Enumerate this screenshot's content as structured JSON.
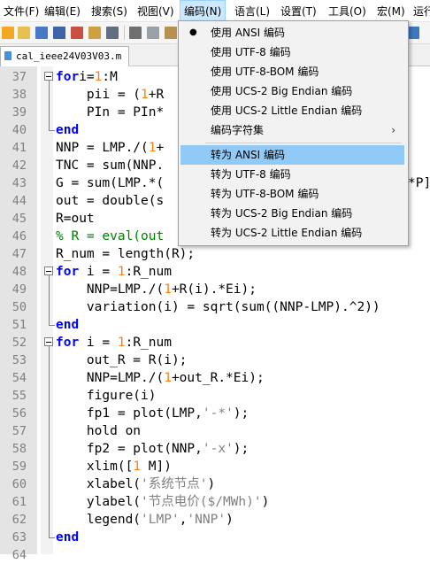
{
  "menubar": {
    "items": [
      {
        "label": "文件(F)"
      },
      {
        "label": "编辑(E)"
      },
      {
        "label": "搜索(S)"
      },
      {
        "label": "视图(V)"
      },
      {
        "label": "编码(N)"
      },
      {
        "label": "语言(L)"
      },
      {
        "label": "设置(T)"
      },
      {
        "label": "工具(O)"
      },
      {
        "label": "宏(M)"
      },
      {
        "label": "运行"
      }
    ]
  },
  "tab": {
    "label": "cal_ieee24V03V03.m"
  },
  "editor": {
    "lines": [
      {
        "n": "37",
        "segs": [
          [
            "kw",
            "for"
          ],
          [
            "",
            "i="
          ],
          [
            "num",
            "1"
          ],
          [
            "",
            ":M"
          ]
        ]
      },
      {
        "n": "38",
        "segs": [
          [
            "",
            "    pii = ("
          ],
          [
            "num",
            "1"
          ],
          [
            "",
            "+R"
          ]
        ]
      },
      {
        "n": "39",
        "segs": [
          [
            "",
            "    PIn = PIn*"
          ]
        ]
      },
      {
        "n": "40",
        "segs": [
          [
            "kw",
            "end"
          ]
        ]
      },
      {
        "n": "41",
        "segs": [
          [
            "",
            "NNP = LMP./("
          ],
          [
            "num",
            "1"
          ],
          [
            "",
            "+"
          ]
        ]
      },
      {
        "n": "42",
        "segs": [
          [
            "",
            "TNC = sum(NNP."
          ]
        ]
      },
      {
        "n": "43",
        "segs": [
          [
            "",
            "G = sum(LMP.*("
          ]
        ]
      },
      {
        "n": "44",
        "segs": [
          [
            "",
            "out = double(s"
          ]
        ]
      },
      {
        "n": "45",
        "segs": [
          [
            "",
            "R=out"
          ]
        ]
      },
      {
        "n": "46",
        "segs": [
          [
            "cmt",
            "% R = eval(out"
          ]
        ]
      },
      {
        "n": "47",
        "segs": [
          [
            "",
            "R_num = length(R);"
          ]
        ]
      },
      {
        "n": "48",
        "segs": [
          [
            "kw",
            "for"
          ],
          [
            "",
            " i = "
          ],
          [
            "num",
            "1"
          ],
          [
            "",
            ":R_num"
          ]
        ]
      },
      {
        "n": "49",
        "segs": [
          [
            "",
            "    NNP=LMP./("
          ],
          [
            "num",
            "1"
          ],
          [
            "",
            "+R(i).*Ei);"
          ]
        ]
      },
      {
        "n": "50",
        "segs": [
          [
            "",
            "    variation(i) = sqrt(sum((NNP-LMP).^2))"
          ]
        ]
      },
      {
        "n": "51",
        "segs": [
          [
            "kw",
            "end"
          ]
        ]
      },
      {
        "n": "52",
        "segs": [
          [
            "kw",
            "for"
          ],
          [
            "",
            " i = "
          ],
          [
            "num",
            "1"
          ],
          [
            "",
            ":R_num"
          ]
        ]
      },
      {
        "n": "53",
        "segs": [
          [
            "",
            "    out_R = R(i);"
          ]
        ]
      },
      {
        "n": "54",
        "segs": [
          [
            "",
            "    NNP=LMP./("
          ],
          [
            "num",
            "1"
          ],
          [
            "",
            "+out_R.*Ei);"
          ]
        ]
      },
      {
        "n": "55",
        "segs": [
          [
            "",
            "    figure(i)"
          ]
        ]
      },
      {
        "n": "56",
        "segs": [
          [
            "",
            "    fp1 = plot(LMP,"
          ],
          [
            "str",
            "'-*'"
          ],
          [
            "",
            ");"
          ]
        ]
      },
      {
        "n": "57",
        "segs": [
          [
            "",
            "    hold on"
          ]
        ]
      },
      {
        "n": "58",
        "segs": [
          [
            "",
            "    fp2 = plot(NNP,"
          ],
          [
            "str",
            "'-x'"
          ],
          [
            "",
            ");"
          ]
        ]
      },
      {
        "n": "59",
        "segs": [
          [
            "",
            "    xlim(["
          ],
          [
            "num",
            "1"
          ],
          [
            "",
            " M])"
          ]
        ]
      },
      {
        "n": "60",
        "segs": [
          [
            "",
            "    xlabel("
          ],
          [
            "str",
            "'系统节点'"
          ],
          [
            "",
            ")"
          ]
        ]
      },
      {
        "n": "61",
        "segs": [
          [
            "",
            "    ylabel("
          ],
          [
            "str",
            "'节点电价($/MWh)'"
          ],
          [
            "",
            ")"
          ]
        ]
      },
      {
        "n": "62",
        "segs": [
          [
            "",
            "    legend("
          ],
          [
            "str",
            "'LMP'"
          ],
          [
            "",
            ","
          ],
          [
            "str",
            "'NNP'"
          ],
          [
            "",
            ")"
          ]
        ]
      },
      {
        "n": "63",
        "segs": [
          [
            "kw",
            "end"
          ]
        ]
      },
      {
        "n": "64",
        "segs": []
      }
    ],
    "line43_tail": "*P]"
  },
  "dropdown": {
    "group1": [
      {
        "label": "使用 ANSI 编码",
        "checked": true
      },
      {
        "label": "使用 UTF-8 编码"
      },
      {
        "label": "使用 UTF-8-BOM 编码"
      },
      {
        "label": "使用 UCS-2 Big Endian 编码"
      },
      {
        "label": "使用 UCS-2 Little Endian 编码"
      },
      {
        "label": "编码字符集",
        "submenu": true
      }
    ],
    "group2": [
      {
        "label": "转为 ANSI 编码",
        "highlighted": true
      },
      {
        "label": "转为 UTF-8 编码"
      },
      {
        "label": "转为 UTF-8-BOM 编码"
      },
      {
        "label": "转为 UCS-2 Big Endian 编码"
      },
      {
        "label": "转为 UCS-2 Little Endian 编码"
      }
    ],
    "check_glyph": "●",
    "arrow_glyph": "›"
  }
}
